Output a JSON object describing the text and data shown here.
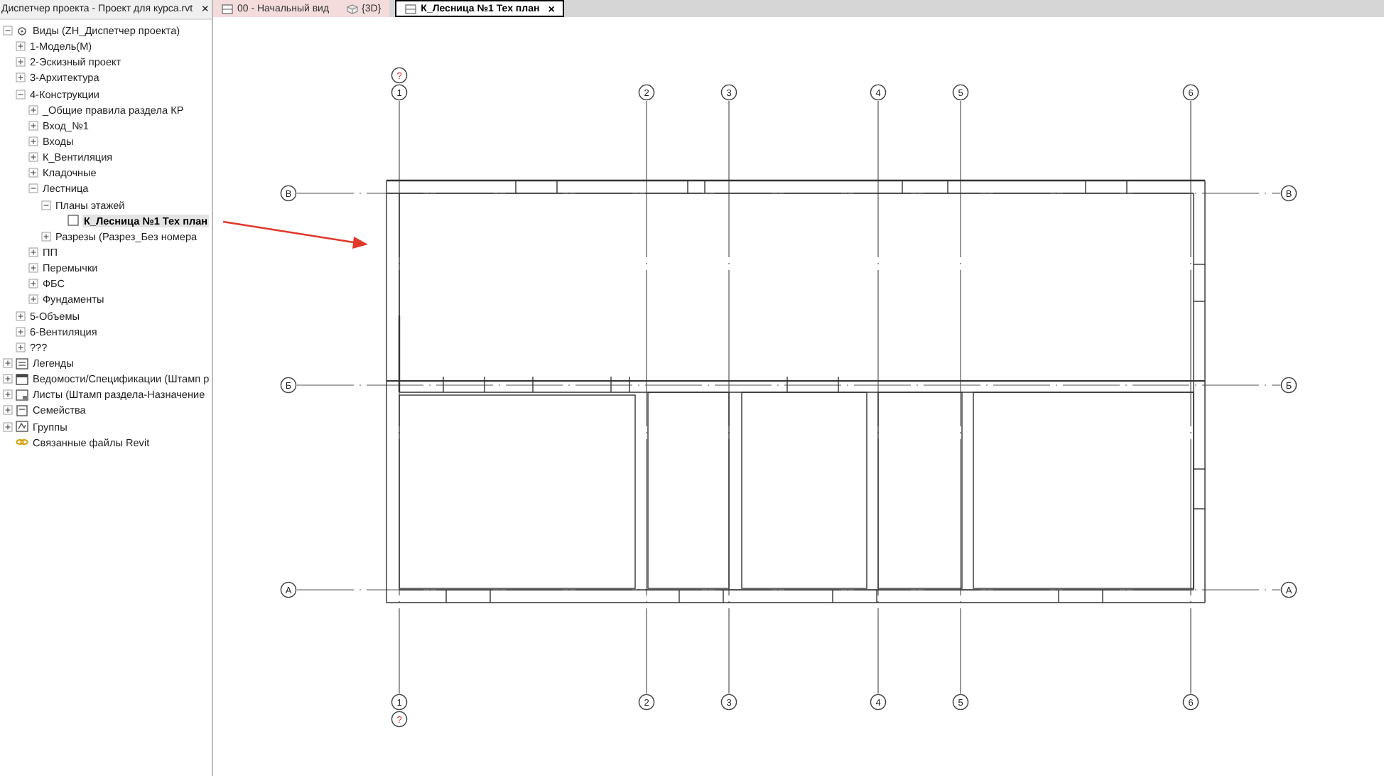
{
  "panel": {
    "title": "Диспетчер проекта - Проект для курса.rvt",
    "close": "×",
    "tree": [
      {
        "label": "Виды (ZH_Диспетчер проекта)",
        "kind": "views",
        "expanded": true,
        "selected": false,
        "children": [
          {
            "label": "1-Модель(М)",
            "expanded": false,
            "selected": false
          },
          {
            "label": "2-Эскизный проект",
            "expanded": false,
            "selected": false
          },
          {
            "label": "3-Архитектура",
            "expanded": false,
            "selected": false
          },
          {
            "label": "4-Конструкции",
            "expanded": true,
            "selected": false,
            "children": [
              {
                "label": "_Общие правила раздела КР",
                "expanded": false,
                "selected": false
              },
              {
                "label": "Вход_№1",
                "expanded": false,
                "selected": false
              },
              {
                "label": "Входы",
                "expanded": false,
                "selected": false
              },
              {
                "label": "К_Вентиляция",
                "expanded": false,
                "selected": false
              },
              {
                "label": "Кладочные",
                "expanded": false,
                "selected": false
              },
              {
                "label": "Лестница",
                "expanded": true,
                "selected": false,
                "children": [
                  {
                    "label": "Планы этажей",
                    "expanded": true,
                    "selected": false,
                    "children": [
                      {
                        "label": "К_Лесница №1 Тех план",
                        "kind": "view",
                        "selected": true
                      }
                    ]
                  },
                  {
                    "label": "Разрезы (Разрез_Без номера",
                    "expanded": false,
                    "selected": false
                  }
                ]
              },
              {
                "label": "ПП",
                "expanded": false,
                "selected": false
              },
              {
                "label": "Перемычки",
                "expanded": false,
                "selected": false
              },
              {
                "label": "ФБС",
                "expanded": false,
                "selected": false
              },
              {
                "label": "Фундаменты",
                "expanded": false,
                "selected": false
              }
            ]
          },
          {
            "label": "5-Объемы",
            "expanded": false,
            "selected": false
          },
          {
            "label": "6-Вентиляция",
            "expanded": false,
            "selected": false
          },
          {
            "label": "???",
            "expanded": false,
            "selected": false
          }
        ]
      },
      {
        "label": "Легенды",
        "kind": "legend",
        "expanded": false,
        "selected": false
      },
      {
        "label": "Ведомости/Спецификации (Штамп р",
        "kind": "schedule",
        "expanded": false,
        "selected": false
      },
      {
        "label": "Листы (Штамп раздела-Назначение",
        "kind": "sheet",
        "expanded": false,
        "selected": false
      },
      {
        "label": "Семейства",
        "kind": "family",
        "expanded": false,
        "selected": false
      },
      {
        "label": "Группы",
        "kind": "group",
        "expanded": false,
        "selected": false
      },
      {
        "label": "Связанные файлы Revit",
        "kind": "link",
        "selected": false
      }
    ]
  },
  "tabs": [
    {
      "label": "00 - Начальный вид",
      "kind": "plan",
      "selected": false
    },
    {
      "label": "{3D}",
      "kind": "model",
      "selected": false
    },
    {
      "label": "К_Лесница №1 Тех план",
      "kind": "plan",
      "selected": true,
      "close": "×"
    }
  ],
  "grids": {
    "vertical": [
      {
        "top_label": "1",
        "bottom_label": "1",
        "markers": [
          "?",
          "?"
        ]
      },
      {
        "top_label": "2",
        "bottom_label": "2"
      },
      {
        "top_label": "3",
        "bottom_label": "3"
      },
      {
        "top_label": "4",
        "bottom_label": "4"
      },
      {
        "top_label": "5",
        "bottom_label": "5"
      },
      {
        "top_label": "6",
        "bottom_label": "6"
      }
    ],
    "horizontal": [
      {
        "left_label": "В",
        "right_label": "В"
      },
      {
        "left_label": "Б",
        "right_label": "Б"
      },
      {
        "left_label": "А",
        "right_label": "А"
      }
    ]
  }
}
